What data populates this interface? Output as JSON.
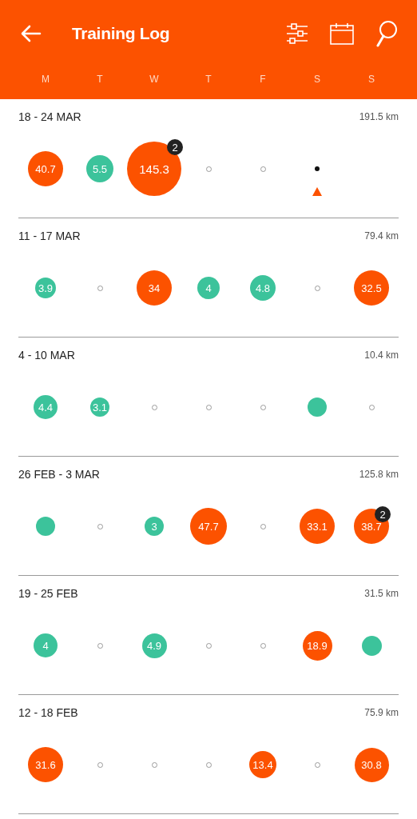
{
  "header": {
    "title": "Training Log",
    "weekdays": [
      "M",
      "T",
      "W",
      "T",
      "F",
      "S",
      "S"
    ]
  },
  "weeks": [
    {
      "range": "18 - 24 MAR",
      "total": "191.5 km",
      "days": [
        {
          "kind": "run",
          "value": "40.7"
        },
        {
          "kind": "other",
          "value": "5.5"
        },
        {
          "kind": "run",
          "value": "145.3",
          "count": "2"
        },
        {
          "kind": "rest"
        },
        {
          "kind": "rest"
        },
        {
          "kind": "today"
        },
        {
          "kind": "none"
        }
      ]
    },
    {
      "range": "11 - 17 MAR",
      "total": "79.4 km",
      "days": [
        {
          "kind": "other",
          "value": "3.9"
        },
        {
          "kind": "rest"
        },
        {
          "kind": "run",
          "value": "34"
        },
        {
          "kind": "other",
          "value": "4"
        },
        {
          "kind": "other",
          "value": "4.8"
        },
        {
          "kind": "rest"
        },
        {
          "kind": "run",
          "value": "32.5"
        }
      ]
    },
    {
      "range": "4 - 10 MAR",
      "total": "10.4 km",
      "days": [
        {
          "kind": "other",
          "value": "4.4"
        },
        {
          "kind": "other",
          "value": "3.1"
        },
        {
          "kind": "rest"
        },
        {
          "kind": "rest"
        },
        {
          "kind": "rest"
        },
        {
          "kind": "other"
        },
        {
          "kind": "rest"
        }
      ]
    },
    {
      "range": "26 FEB - 3 MAR",
      "total": "125.8 km",
      "days": [
        {
          "kind": "other"
        },
        {
          "kind": "rest"
        },
        {
          "kind": "other",
          "value": "3"
        },
        {
          "kind": "run",
          "value": "47.7"
        },
        {
          "kind": "rest"
        },
        {
          "kind": "run",
          "value": "33.1"
        },
        {
          "kind": "run",
          "value": "38.7",
          "count": "2"
        }
      ]
    },
    {
      "range": "19 - 25 FEB",
      "total": "31.5 km",
      "days": [
        {
          "kind": "other",
          "value": "4"
        },
        {
          "kind": "rest"
        },
        {
          "kind": "other",
          "value": "4.9"
        },
        {
          "kind": "rest"
        },
        {
          "kind": "rest"
        },
        {
          "kind": "run",
          "value": "18.9"
        },
        {
          "kind": "other"
        }
      ]
    },
    {
      "range": "12 - 18 FEB",
      "total": "75.9 km",
      "days": [
        {
          "kind": "run",
          "value": "31.6"
        },
        {
          "kind": "rest"
        },
        {
          "kind": "rest"
        },
        {
          "kind": "rest"
        },
        {
          "kind": "run",
          "value": "13.4"
        },
        {
          "kind": "rest"
        },
        {
          "kind": "run",
          "value": "30.8"
        }
      ]
    }
  ]
}
